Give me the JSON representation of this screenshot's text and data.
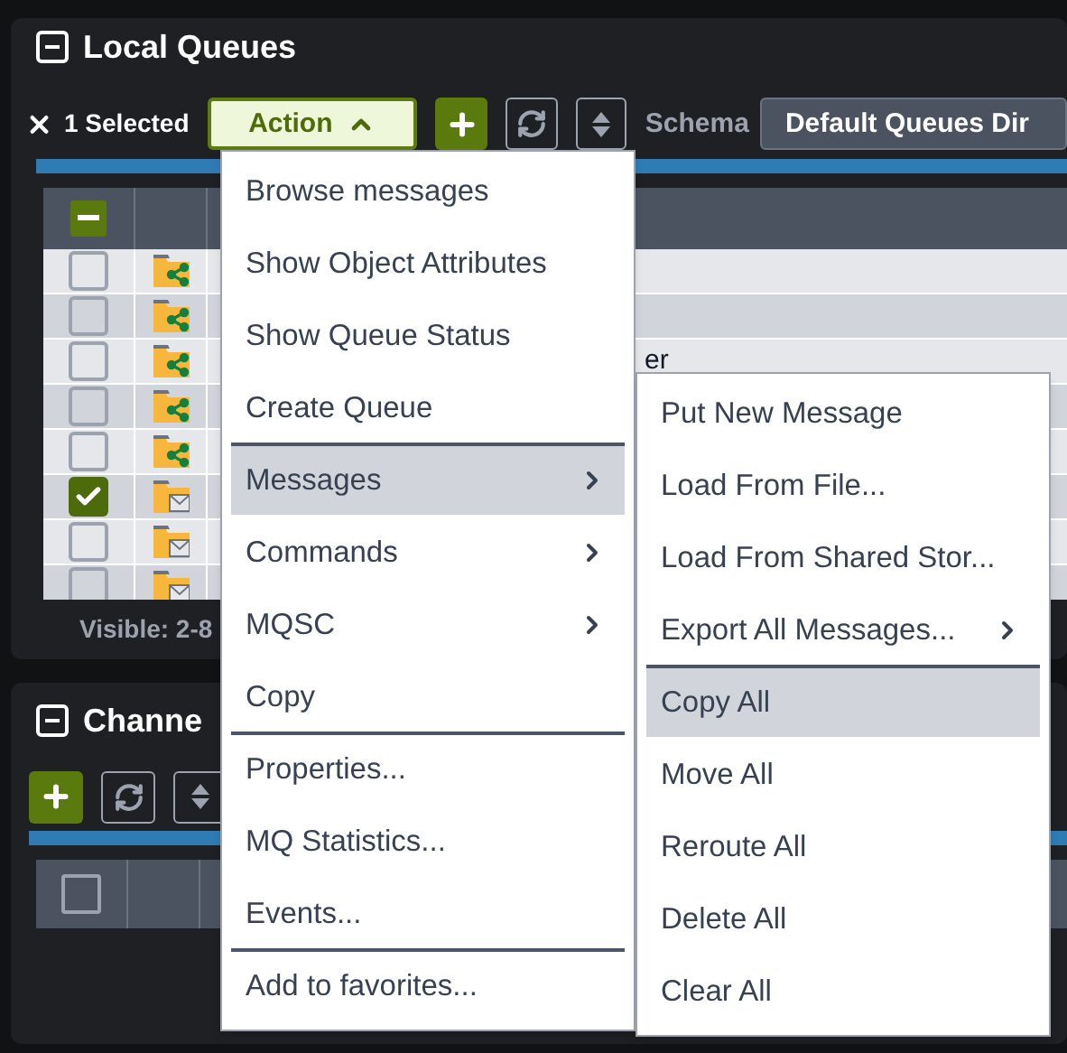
{
  "queues_panel": {
    "title": "Local Queues",
    "expanded": true,
    "selection": {
      "label": "1 Selected"
    },
    "action_button": {
      "label": "Action",
      "open": true
    },
    "schema": {
      "label": "Schema",
      "value": "Default Queues Dir"
    },
    "rows": [
      {
        "checked": false,
        "kind": "shared",
        "name": ""
      },
      {
        "checked": false,
        "kind": "shared",
        "name": ""
      },
      {
        "checked": false,
        "kind": "shared",
        "name": "er"
      },
      {
        "checked": false,
        "kind": "shared",
        "name": ""
      },
      {
        "checked": false,
        "kind": "shared",
        "name": ""
      },
      {
        "checked": true,
        "kind": "mail",
        "name": ""
      },
      {
        "checked": false,
        "kind": "mail",
        "name": ""
      },
      {
        "checked": false,
        "kind": "mail",
        "name": ""
      }
    ],
    "status": "Visible: 2-8",
    "select_all": {
      "checked": true,
      "partial": true
    }
  },
  "channels_panel": {
    "title": "Channe",
    "expanded": true,
    "select_all": {
      "checked": false,
      "partial": false
    }
  },
  "action_menu": [
    {
      "label": "Browse messages",
      "highlighted": false,
      "submenu": false,
      "divider_after": false
    },
    {
      "label": "Show Object Attributes",
      "highlighted": false,
      "submenu": false,
      "divider_after": false
    },
    {
      "label": "Show Queue Status",
      "highlighted": false,
      "submenu": false,
      "divider_after": false
    },
    {
      "label": "Create Queue",
      "highlighted": false,
      "submenu": false,
      "divider_after": true
    },
    {
      "label": "Messages",
      "highlighted": true,
      "submenu": true,
      "divider_after": false
    },
    {
      "label": "Commands",
      "highlighted": false,
      "submenu": true,
      "divider_after": false
    },
    {
      "label": "MQSC",
      "highlighted": false,
      "submenu": true,
      "divider_after": false
    },
    {
      "label": "Copy",
      "highlighted": false,
      "submenu": false,
      "divider_after": true
    },
    {
      "label": "Properties...",
      "highlighted": false,
      "submenu": false,
      "divider_after": false
    },
    {
      "label": "MQ Statistics...",
      "highlighted": false,
      "submenu": false,
      "divider_after": false
    },
    {
      "label": "Events...",
      "highlighted": false,
      "submenu": false,
      "divider_after": true
    },
    {
      "label": "Add to favorites...",
      "highlighted": false,
      "submenu": false,
      "divider_after": false
    }
  ],
  "messages_submenu": [
    {
      "label": "Put New Message",
      "highlighted": false,
      "submenu": false,
      "divider_after": false
    },
    {
      "label": "Load From File...",
      "highlighted": false,
      "submenu": false,
      "divider_after": false
    },
    {
      "label": "Load From Shared Stor...",
      "highlighted": false,
      "submenu": false,
      "divider_after": false
    },
    {
      "label": "Export All Messages...",
      "highlighted": false,
      "submenu": true,
      "divider_after": true
    },
    {
      "label": "Copy All",
      "highlighted": true,
      "submenu": false,
      "divider_after": false
    },
    {
      "label": "Move All",
      "highlighted": false,
      "submenu": false,
      "divider_after": false
    },
    {
      "label": "Reroute All",
      "highlighted": false,
      "submenu": false,
      "divider_after": false
    },
    {
      "label": "Delete All",
      "highlighted": false,
      "submenu": false,
      "divider_after": false
    },
    {
      "label": "Clear All",
      "highlighted": false,
      "submenu": false,
      "divider_after": false
    }
  ]
}
